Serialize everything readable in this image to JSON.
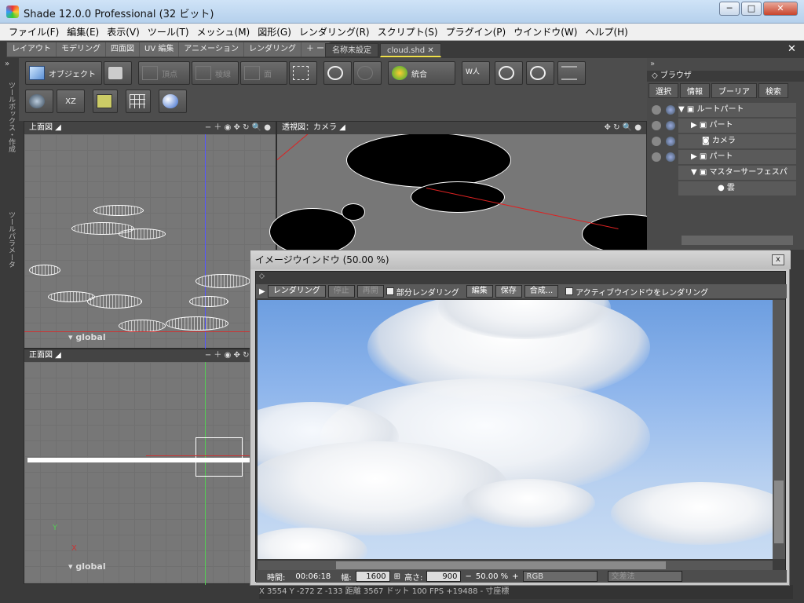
{
  "window": {
    "title": "Shade 12.0.0 Professional (32 ビット)",
    "min": "─",
    "max": "□",
    "close": "✕"
  },
  "menu": [
    "ファイル(F)",
    "編集(E)",
    "表示(V)",
    "ツール(T)",
    "メッシュ(M)",
    "図形(G)",
    "レンダリング(R)",
    "スクリプト(S)",
    "プラグイン(P)",
    "ウインドウ(W)",
    "ヘルプ(H)"
  ],
  "modetabs": [
    "レイアウト",
    "モデリング",
    "四面図",
    "UV 編集",
    "アニメーション",
    "レンダリング",
    "＋ ー"
  ],
  "doctabs": [
    "名称未設定",
    "cloud.shd"
  ],
  "doc_close": "✕",
  "side": {
    "toolbox": "ツールボックス・作成",
    "param": "ツールパラメータ"
  },
  "toolbar": {
    "object": "オブジェクト",
    "vertex": "頂点",
    "edge": "稜線",
    "face": "面",
    "merge": "統合",
    "xz": "XZ"
  },
  "views": {
    "top": {
      "label": "上面図",
      "ctl": "− ＋ ◉ ✥ ↻ 🔍 ●",
      "global": "global"
    },
    "persp": {
      "label": "透視図：カメラ",
      "ctl": "✥ ↻ 🔍 ●"
    },
    "front": {
      "label": "正面図",
      "ctl": "− ＋ ◉ ✥ ↻ 🔍 ●",
      "global": "global",
      "axis_y": "Y",
      "axis_x": "X"
    }
  },
  "browser": {
    "header": "ブラウザ",
    "tabs": [
      "選択",
      "情報",
      "ブーリア",
      "検索"
    ],
    "tree": [
      "ルートパート",
      "パート",
      "カメラ",
      "パート",
      "マスターサーフェスパ",
      "雲"
    ]
  },
  "imagewin": {
    "title": "イメージウインドウ (50.00 %)",
    "close": "x",
    "buttons": {
      "render": "レンダリング",
      "stop": "停止",
      "resume": "再開",
      "partial": "部分レンダリング",
      "edit": "編集",
      "save": "保存",
      "composite": "合成...",
      "active": "アクティブウインドウをレンダリング"
    },
    "status": {
      "time_label": "時間:",
      "time": "00:06:18",
      "width_label": "幅:",
      "width": "1600",
      "height_label": "高さ:",
      "height": "900",
      "zoom": "50.00 %",
      "color": "RGB",
      "method": "交差法"
    }
  },
  "statusbar": {
    "text": "X    3554    Y    -272    Z    -133    距離    3567    ドット    100   FPS +19488    - 寸座標"
  }
}
